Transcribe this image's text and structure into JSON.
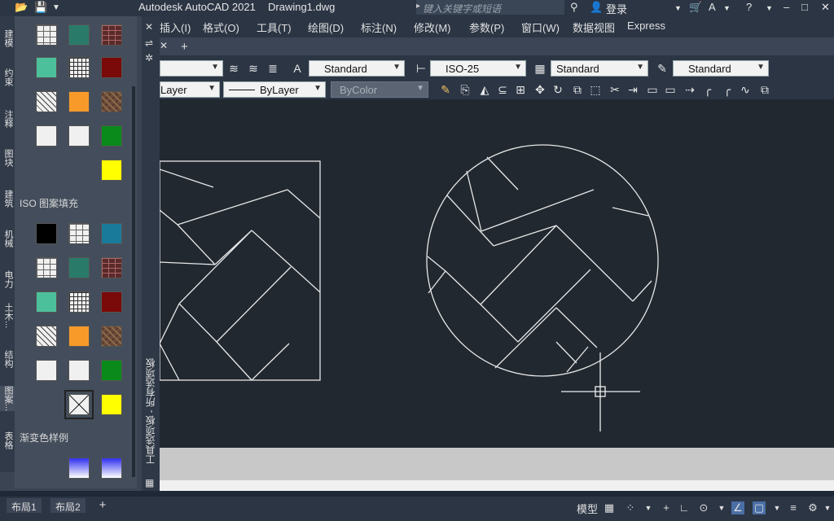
{
  "titlebar": {
    "app_title": "Autodesk AutoCAD 2021",
    "doc_title": "Drawing1.dwg",
    "search_placeholder": "键入关键字或短语",
    "login_label": "登录"
  },
  "menubar": {
    "items": [
      "插入(I)",
      "格式(O)",
      "工具(T)",
      "绘图(D)",
      "标注(N)",
      "修改(M)",
      "参数(P)",
      "窗口(W)",
      "数据视图",
      "Express"
    ]
  },
  "ribbon": {
    "text_style": "Standard",
    "dim_style": "ISO-25",
    "table_style": "Standard",
    "multileader_style": "Standard",
    "layer": "Layer",
    "linetype": "ByLayer",
    "color": "ByColor"
  },
  "palette": {
    "side_tabs": [
      "建模",
      "约束",
      "注释",
      "图块",
      "建筑",
      "机械",
      "电力",
      "土木...",
      "结构",
      "图案...",
      "表格"
    ],
    "section_iso": "ISO 图案填充",
    "section_gradient": "渐变色样例",
    "vertical_title": "工具选项板 - 所有选项板",
    "colors": {
      "teal": "#2a7a6a",
      "mint": "#4cc09a",
      "maroon": "#7a0a0a",
      "orange": "#f79a2a",
      "green": "#0a8a1a",
      "yellow": "#ffff00",
      "black": "#000000",
      "steelblue": "#1a7a9a"
    }
  },
  "statusbar": {
    "layout_tabs": [
      "布局1",
      "布局2"
    ],
    "model_label": "模型"
  }
}
